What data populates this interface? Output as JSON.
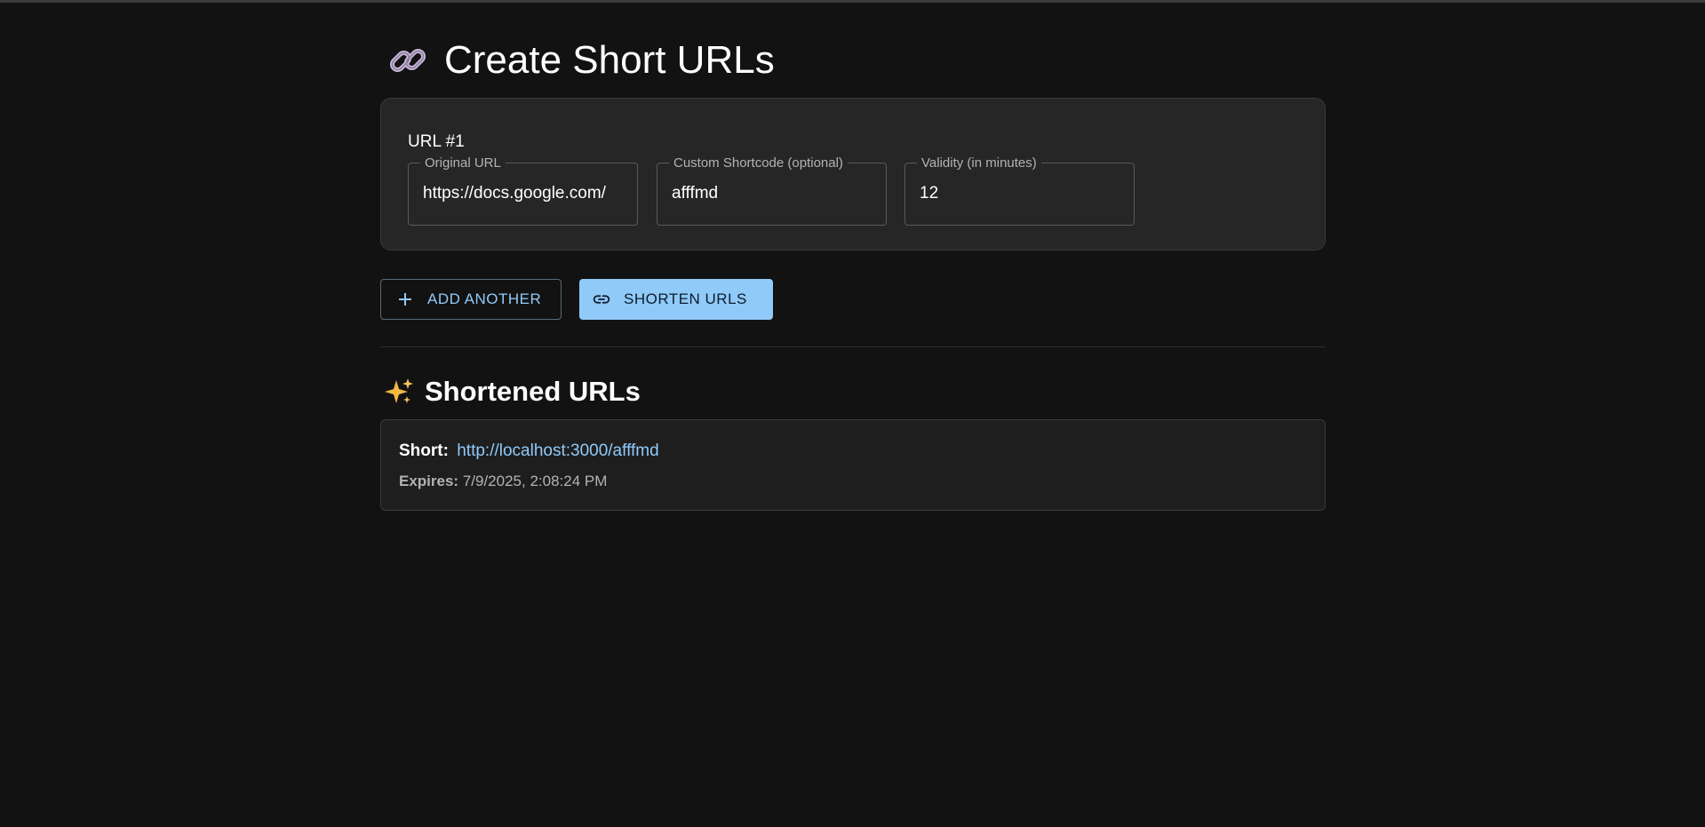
{
  "page": {
    "title": "Create Short URLs",
    "title_icon": "link-emoji-icon"
  },
  "form": {
    "entries": [
      {
        "label": "URL #1",
        "original_url_label": "Original URL",
        "original_url_value": "https://docs.google.com/",
        "shortcode_label": "Custom Shortcode (optional)",
        "shortcode_value": "afffmd",
        "validity_label": "Validity (in minutes)",
        "validity_value": "12"
      }
    ]
  },
  "actions": {
    "add_label": "Add Another",
    "add_icon": "plus-icon",
    "shorten_label": "Shorten URLs",
    "shorten_icon": "link-icon"
  },
  "results": {
    "title": "Shortened URLs",
    "title_icon": "sparkles-icon",
    "items": [
      {
        "short_key": "Short:",
        "short_url": "http://localhost:3000/afffmd",
        "expires_key": "Expires:",
        "expires_value": "7/9/2025, 2:08:24 PM"
      }
    ]
  },
  "colors": {
    "background": "#121212",
    "card": "#262626",
    "accent": "#90caf9"
  }
}
